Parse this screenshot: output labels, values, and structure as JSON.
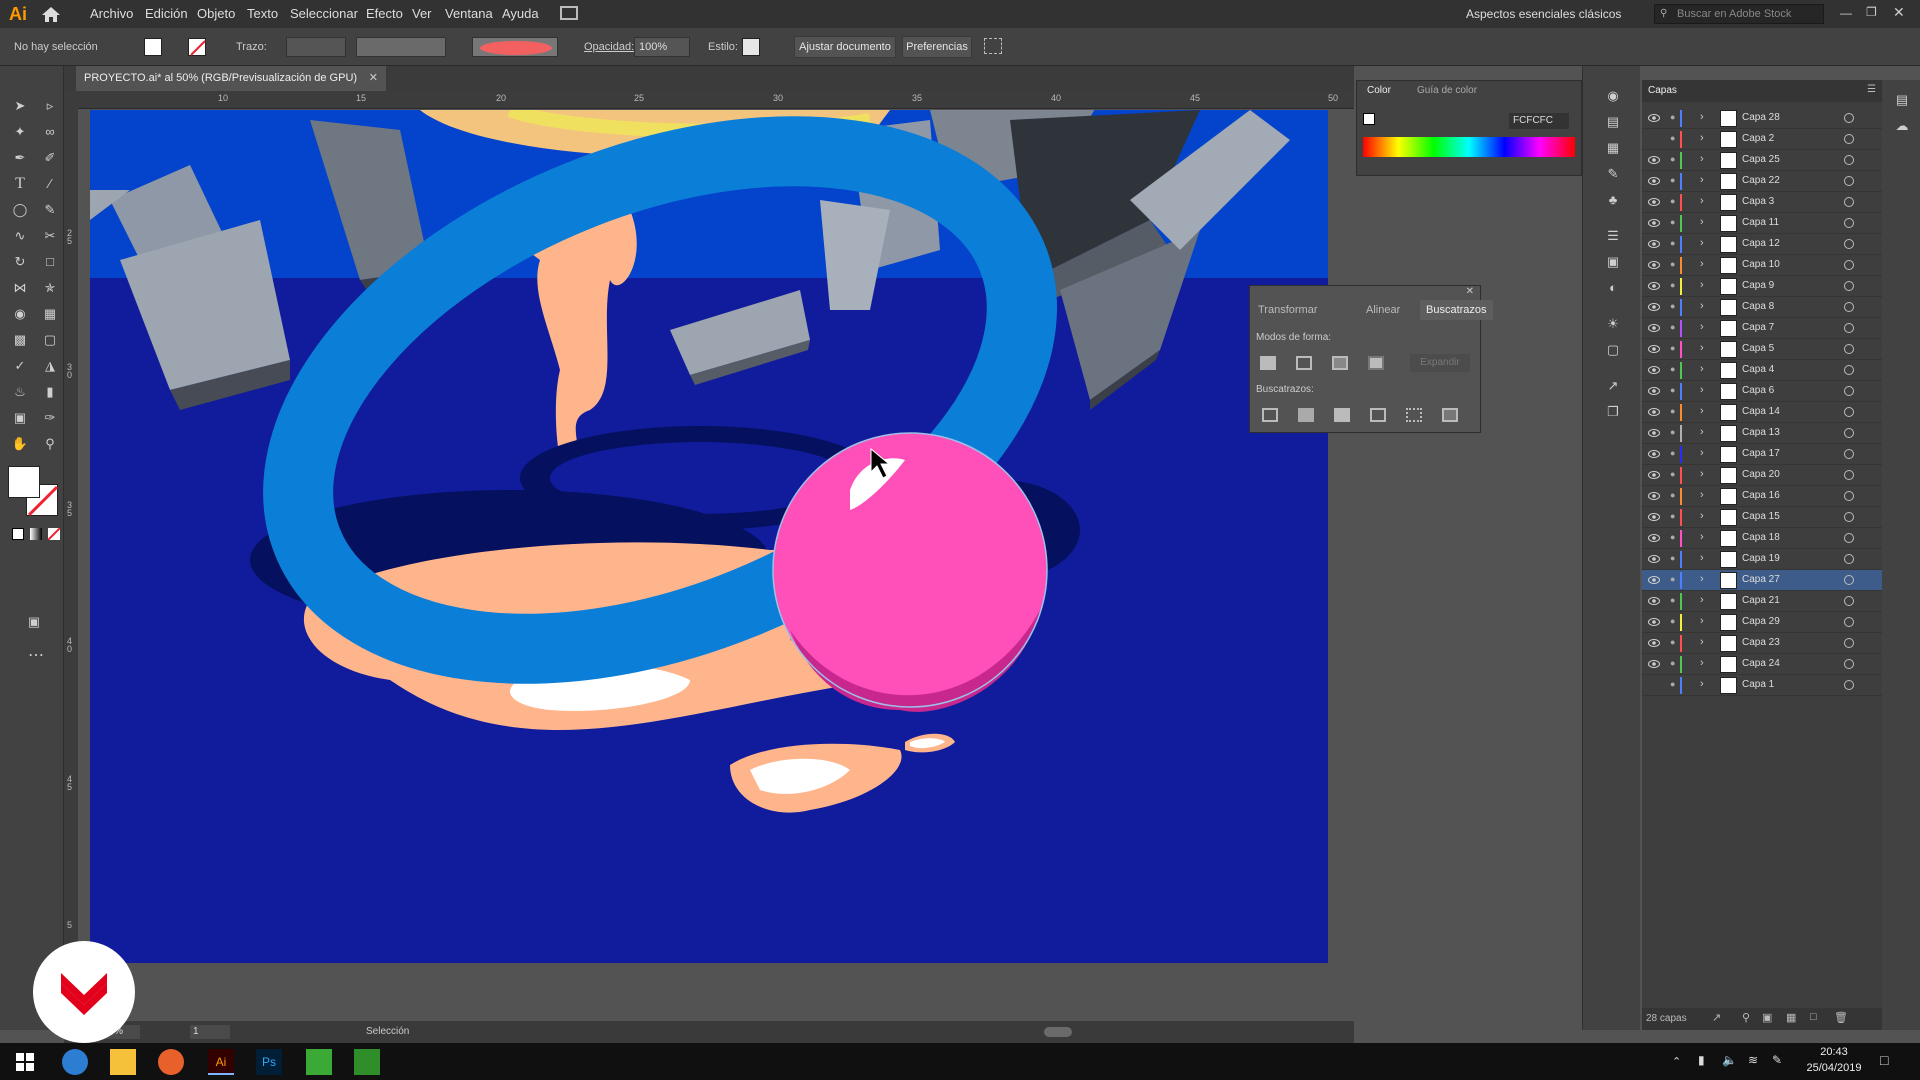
{
  "menubar": {
    "logo": "Ai",
    "items": [
      "Archivo",
      "Edición",
      "Objeto",
      "Texto",
      "Seleccionar",
      "Efecto",
      "Ver",
      "Ventana",
      "Ayuda"
    ],
    "workspace": "Aspectos esenciales clásicos",
    "stock_search_placeholder": "Buscar en Adobe Stock"
  },
  "controlbar": {
    "selection_state": "No hay selección",
    "stroke_label": "Trazo:",
    "opacity_label": "Opacidad:",
    "opacity_value": "100%",
    "style_label": "Estilo:",
    "fit_document_button": "Ajustar documento",
    "preferences_button": "Preferencias"
  },
  "document": {
    "tab_title": "PROYECTO.ai* al 50% (RGB/Previsualización de GPU)",
    "ruler_top_labels": [
      "10",
      "15",
      "20",
      "25",
      "30",
      "35",
      "40",
      "45",
      "50"
    ],
    "ruler_left_labels": [
      "2 5",
      "3 0",
      "3 5",
      "4 0",
      "4 5",
      "5"
    ],
    "zoom": "50%",
    "page_number": "1",
    "status": "Selección"
  },
  "colors": {
    "canvas_bg": "#101c9b",
    "sky": "#0444cc",
    "ring": "#0b7ed8",
    "sphere": "#ff4fb8",
    "puddle": "#ffb58c",
    "accent_logo": "#ff9a00"
  },
  "color_panel": {
    "tabs": [
      "Color",
      "Guía de color"
    ],
    "hex_value": "FCFCFC"
  },
  "pathfinder_panel": {
    "tabs": [
      "Transformar",
      "Alinear",
      "Buscatrazos"
    ],
    "shape_modes_label": "Modos de forma:",
    "expand_button": "Expandir",
    "pathfinders_label": "Buscatrazos:"
  },
  "layers_panel": {
    "title": "Capas",
    "count_label": "28 capas",
    "layers": [
      {
        "name": "Capa 28",
        "color": "#4f7fff",
        "selected": false,
        "visible": true
      },
      {
        "name": "Capa 2",
        "color": "#ff4f4f",
        "selected": false,
        "visible": false
      },
      {
        "name": "Capa 25",
        "color": "#50c850",
        "selected": false,
        "visible": true
      },
      {
        "name": "Capa 22",
        "color": "#4f7fff",
        "selected": false,
        "visible": true
      },
      {
        "name": "Capa 3",
        "color": "#ff4f4f",
        "selected": false,
        "visible": true
      },
      {
        "name": "Capa 11",
        "color": "#50c850",
        "selected": false,
        "visible": true
      },
      {
        "name": "Capa 12",
        "color": "#4f7fff",
        "selected": false,
        "visible": true
      },
      {
        "name": "Capa 10",
        "color": "#ff8a2a",
        "selected": false,
        "visible": true
      },
      {
        "name": "Capa 9",
        "color": "#f0f040",
        "selected": false,
        "visible": true
      },
      {
        "name": "Capa 8",
        "color": "#4f7fff",
        "selected": false,
        "visible": true
      },
      {
        "name": "Capa 7",
        "color": "#b050ff",
        "selected": false,
        "visible": true
      },
      {
        "name": "Capa 5",
        "color": "#ff50c8",
        "selected": false,
        "visible": true
      },
      {
        "name": "Capa 4",
        "color": "#50c850",
        "selected": false,
        "visible": true
      },
      {
        "name": "Capa 6",
        "color": "#4f7fff",
        "selected": false,
        "visible": true
      },
      {
        "name": "Capa 14",
        "color": "#ff8a2a",
        "selected": false,
        "visible": true
      },
      {
        "name": "Capa 13",
        "color": "#b0b0b0",
        "selected": false,
        "visible": true
      },
      {
        "name": "Capa 17",
        "color": "#2a2aff",
        "selected": false,
        "visible": true
      },
      {
        "name": "Capa 20",
        "color": "#ff4f4f",
        "selected": false,
        "visible": true
      },
      {
        "name": "Capa 16",
        "color": "#ff8a2a",
        "selected": false,
        "visible": true
      },
      {
        "name": "Capa 15",
        "color": "#ff4f4f",
        "selected": false,
        "visible": true
      },
      {
        "name": "Capa 18",
        "color": "#ff50c8",
        "selected": false,
        "visible": true
      },
      {
        "name": "Capa 19",
        "color": "#4f7fff",
        "selected": false,
        "visible": true
      },
      {
        "name": "Capa 27",
        "color": "#4f7fff",
        "selected": true,
        "visible": true
      },
      {
        "name": "Capa 21",
        "color": "#50c850",
        "selected": false,
        "visible": true
      },
      {
        "name": "Capa 29",
        "color": "#f0f040",
        "selected": false,
        "visible": true
      },
      {
        "name": "Capa 23",
        "color": "#ff4f4f",
        "selected": false,
        "visible": true
      },
      {
        "name": "Capa 24",
        "color": "#50c850",
        "selected": false,
        "visible": true
      },
      {
        "name": "Capa 1",
        "color": "#4f7fff",
        "selected": false,
        "visible": false
      }
    ]
  },
  "taskbar": {
    "time": "20:43",
    "date": "25/04/2019"
  }
}
